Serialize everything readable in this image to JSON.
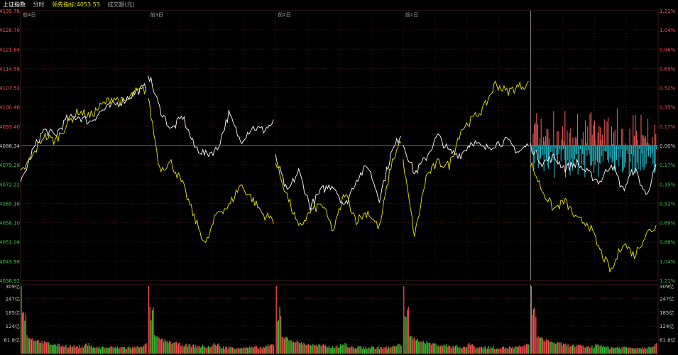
{
  "header": {
    "index_name": "上证指数",
    "mode": "分时",
    "leading_indicator": "领先指标:4053.53",
    "volume_label": "成交额(元)"
  },
  "colors": {
    "background": "#000000",
    "grid": "#3a1a1a",
    "up": "#ff5050",
    "down": "#33cc33",
    "price_line": "#ffffff",
    "lead_line": "#e8e800",
    "sell_bar": "#22c8d8",
    "buy_bar": "#ff6060",
    "axis_text": "#c8c8c8"
  },
  "chart_data": {
    "type": "line",
    "day_labels": [
      "前4日",
      "前3日",
      "前2日",
      "前1日",
      ""
    ],
    "prev_close": 4086.34,
    "price_ticks": [
      4135.76,
      4128.7,
      4121.64,
      4114.58,
      4107.52,
      4100.46,
      4093.4,
      4086.34,
      4079.28,
      4072.22,
      4065.16,
      4058.1,
      4051.04,
      4043.98,
      4036.92
    ],
    "pct_ticks": [
      "1.21%",
      "1.04%",
      "0.86%",
      "0.69%",
      "0.52%",
      "0.35%",
      "0.17%",
      "0.00%",
      "0.17%",
      "0.35%",
      "0.52%",
      "0.69%",
      "0.86%",
      "1.04%",
      "1.21%"
    ],
    "ylim": [
      4036.92,
      4135.76
    ],
    "volume_ticks": [
      "309亿",
      "247亿",
      "185亿",
      "124亿",
      "61.8亿"
    ],
    "volume_max": 309,
    "series": [
      {
        "key": "price",
        "values": [
          [
            4072,
            4084,
            4092,
            4090,
            4096,
            4097,
            4095,
            4099,
            4101,
            4103,
            4106,
            4108
          ],
          [
            4113,
            4100,
            4092,
            4097,
            4086,
            4083,
            4085,
            4098,
            4088,
            4093,
            4092,
            4095
          ],
          [
            4082,
            4069,
            4077,
            4064,
            4070,
            4072,
            4064,
            4074,
            4079,
            4067,
            4083,
            4092
          ],
          [
            4087,
            4076,
            4082,
            4090,
            4084,
            4083,
            4088,
            4085,
            4087,
            4088,
            4084,
            4087
          ],
          [
            4086,
            4080,
            4082,
            4078,
            4080,
            4076,
            4073,
            4080,
            4070,
            4078,
            4068,
            4080
          ]
        ]
      },
      {
        "key": "lead",
        "values": [
          [
            4076,
            4082,
            4090,
            4088,
            4094,
            4099,
            4097,
            4101,
            4104,
            4102,
            4106,
            4107
          ],
          [
            4104,
            4078,
            4080,
            4072,
            4060,
            4050,
            4062,
            4064,
            4072,
            4067,
            4061,
            4059
          ],
          [
            4080,
            4068,
            4056,
            4062,
            4065,
            4055,
            4069,
            4059,
            4062,
            4056,
            4079,
            4090
          ],
          [
            4080,
            4053,
            4075,
            4080,
            4079,
            4092,
            4096,
            4100,
            4109,
            4106,
            4108,
            4109
          ],
          [
            4080,
            4070,
            4063,
            4066,
            4059,
            4058,
            4048,
            4040,
            4051,
            4046,
            4054,
            4057
          ]
        ]
      }
    ]
  }
}
